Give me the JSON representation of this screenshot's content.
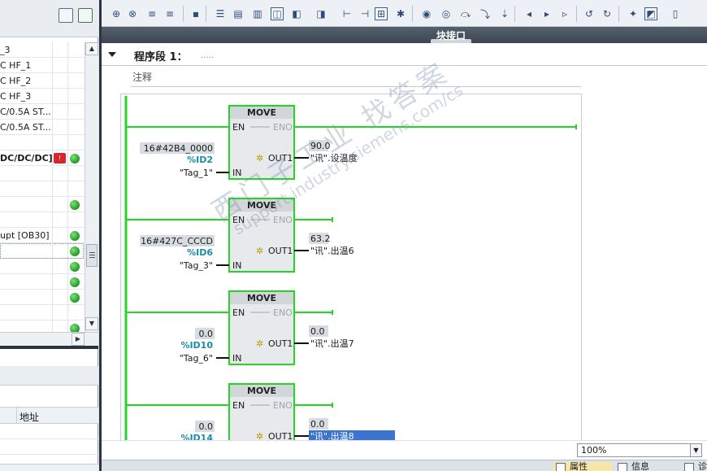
{
  "left_tree": {
    "rows": [
      {
        "label": "_3",
        "status": ""
      },
      {
        "label": "C HF_1",
        "status": ""
      },
      {
        "label": "C HF_2",
        "status": ""
      },
      {
        "label": "C HF_3",
        "status": ""
      },
      {
        "label": "C/0.5A ST...",
        "status": ""
      },
      {
        "label": "C/0.5A ST...",
        "status": ""
      },
      {
        "label": "",
        "status": ""
      },
      {
        "label": "DC/DC/DC]",
        "status": "error-ok"
      },
      {
        "label": "",
        "status": ""
      },
      {
        "label": "",
        "status": ""
      },
      {
        "label": "",
        "status": "ok"
      },
      {
        "label": "",
        "status": ""
      },
      {
        "label": "upt [OB30]",
        "status": "ok"
      },
      {
        "label": "",
        "status": "ok"
      },
      {
        "label": "",
        "status": "ok"
      },
      {
        "label": "",
        "status": "ok"
      },
      {
        "label": "",
        "status": "ok"
      },
      {
        "label": "",
        "status": ""
      },
      {
        "label": "",
        "status": "ok"
      }
    ]
  },
  "left_lower": {
    "address_header": "地址"
  },
  "editor": {
    "interface_label": "块接口",
    "network_title": "程序段 1：",
    "network_dots": ".....",
    "comment": "注释",
    "zoom": "100%"
  },
  "bottom_tabs": {
    "properties": "属性",
    "info": "信息",
    "diagnostics": "诊"
  },
  "watermark": {
    "line1": "西门子工业  找答案",
    "line2": "support.industry.siemens.com/cs"
  },
  "ladder": {
    "box_title": "MOVE",
    "en": "EN",
    "eno": "ENO",
    "in": "IN",
    "out": "OUT1",
    "blocks": [
      {
        "const": "16#42B4_0000",
        "in_addr": "%ID2",
        "in_tag": "\"Tag_1\"",
        "out_val": "90.0",
        "out_tag": "\"讯\".设温度"
      },
      {
        "const": "16#427C_CCCD",
        "in_addr": "%ID6",
        "in_tag": "\"Tag_3\"",
        "out_val": "63.2",
        "out_tag": "\"讯\".出温6"
      },
      {
        "const": "0.0",
        "in_addr": "%ID10",
        "in_tag": "\"Tag_6\"",
        "out_val": "0.0",
        "out_tag": "\"讯\".出温7"
      },
      {
        "const": "0.0",
        "in_addr": "%ID14",
        "in_tag": "",
        "out_val": "0.0",
        "out_tag": "\"讯\".出温8"
      }
    ]
  }
}
